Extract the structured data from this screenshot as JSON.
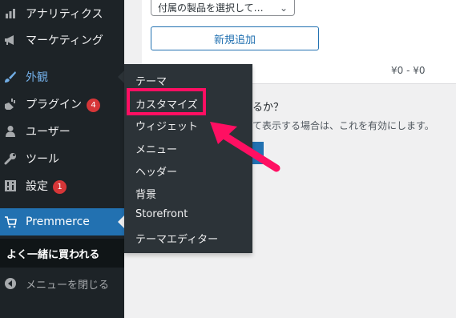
{
  "sidebar": {
    "items": [
      {
        "label": "アナリティクス",
        "icon": "bar-chart-icon"
      },
      {
        "label": "マーケティング",
        "icon": "megaphone-icon"
      },
      {
        "label": "外観",
        "icon": "paintbrush-icon"
      },
      {
        "label": "プラグイン",
        "icon": "plugin-icon",
        "badge": "4"
      },
      {
        "label": "ユーザー",
        "icon": "user-icon"
      },
      {
        "label": "ツール",
        "icon": "wrench-icon"
      },
      {
        "label": "設定",
        "icon": "settings-icon",
        "badge": "1"
      },
      {
        "label": "Premmerce",
        "icon": "cart-icon"
      },
      {
        "label": "よく一緒に買われる"
      },
      {
        "label": "メニューを閉じる",
        "icon": "collapse-icon"
      }
    ]
  },
  "flyout": {
    "items": [
      "テーマ",
      "カスタマイズ",
      "ウィジェット",
      "メニュー",
      "ヘッダー",
      "背景",
      "Storefront",
      "テーマエディター"
    ],
    "highlighted": "カスタマイズ"
  },
  "content": {
    "select_value": "付属の製品を選択して…",
    "add_button": "新規追加",
    "price_range": "¥0 - ¥0",
    "question": "るか？",
    "description": "て表示する場合は、これを有効にします。"
  },
  "colors": {
    "accent": "#2271b1",
    "highlight": "#ff0f62",
    "sidebar_bg": "#1d2327"
  }
}
